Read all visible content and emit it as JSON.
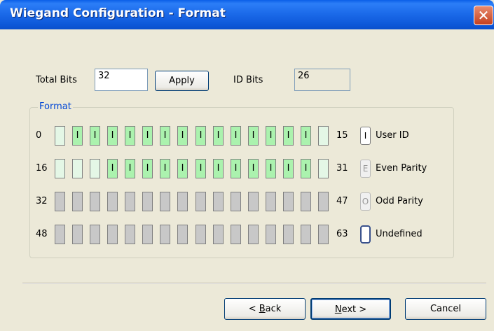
{
  "window": {
    "title": "Wiegand Configuration - Format",
    "close_symbol": "✕"
  },
  "settings": {
    "total_bits_label": "Total Bits",
    "total_bits_value": "32",
    "apply_label": "Apply",
    "id_bits_label": "ID Bits",
    "id_bits_value": "26"
  },
  "format_group": {
    "title": "Format",
    "rows": [
      {
        "start": "0",
        "end": "15",
        "bits": [
          "P",
          "I",
          "I",
          "I",
          "I",
          "I",
          "I",
          "I",
          "I",
          "I",
          "I",
          "I",
          "I",
          "I",
          "I",
          "P"
        ]
      },
      {
        "start": "16",
        "end": "31",
        "bits": [
          "P",
          "P",
          "P",
          "I",
          "I",
          "I",
          "I",
          "I",
          "I",
          "I",
          "I",
          "I",
          "I",
          "I",
          "I",
          "P"
        ]
      },
      {
        "start": "32",
        "end": "47",
        "bits": [
          "U",
          "U",
          "U",
          "U",
          "U",
          "U",
          "U",
          "U",
          "U",
          "U",
          "U",
          "U",
          "U",
          "U",
          "U",
          "U"
        ]
      },
      {
        "start": "48",
        "end": "63",
        "bits": [
          "U",
          "U",
          "U",
          "U",
          "U",
          "U",
          "U",
          "U",
          "U",
          "U",
          "U",
          "U",
          "U",
          "U",
          "U",
          "U"
        ]
      }
    ],
    "bit_glyphs": {
      "I": "I",
      "P": "",
      "U": ""
    },
    "legend": [
      {
        "glyph": "I",
        "label": "User ID"
      },
      {
        "glyph": "E",
        "label": "Even Parity"
      },
      {
        "glyph": "O",
        "label": "Odd Parity"
      },
      {
        "glyph": "",
        "label": "Undefined"
      }
    ]
  },
  "footer": {
    "back_prefix": "< ",
    "back_mnemonic": "B",
    "back_rest": "ack",
    "next_mnemonic": "N",
    "next_rest": "ext >",
    "cancel_label": "Cancel"
  },
  "colors": {
    "id_bit": "#ABF2AE",
    "parity_bit": "#E4F7E6",
    "undefined_bit": "#C8C8C8",
    "title_bar": "#0A5FE8",
    "group_title": "#0046D5"
  }
}
